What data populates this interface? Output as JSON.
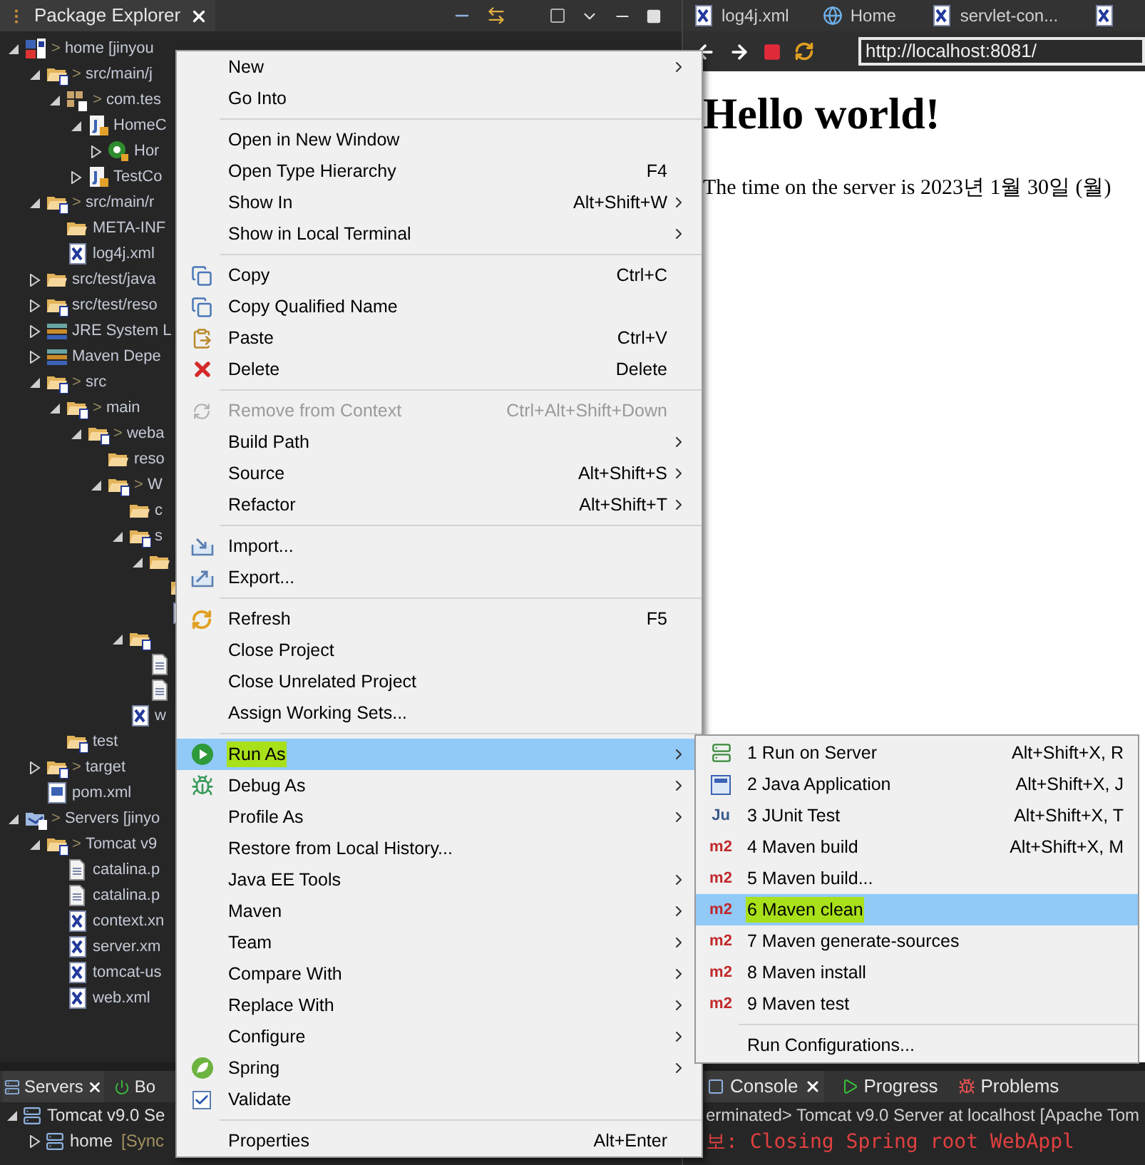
{
  "package_explorer": {
    "title": "Package Explorer",
    "tree": [
      {
        "kind": "project",
        "marker": ">",
        "label": "home [jinyou",
        "expanded": true,
        "children": [
          {
            "kind": "srcfolder",
            "marker": ">",
            "label": "src/main/j",
            "expanded": true,
            "children": [
              {
                "kind": "package",
                "marker": ">",
                "label": "com.tes",
                "expanded": true,
                "children": [
                  {
                    "kind": "javafile",
                    "label": "HomeC",
                    "expanded": true,
                    "children": [
                      {
                        "kind": "class",
                        "label": "Hor",
                        "expanded": false
                      }
                    ]
                  },
                  {
                    "kind": "javafile",
                    "label": "TestCo",
                    "expanded": false
                  }
                ]
              }
            ]
          },
          {
            "kind": "srcfolder",
            "marker": ">",
            "label": "src/main/r",
            "expanded": true,
            "children": [
              {
                "kind": "folder",
                "label": "META-INF"
              },
              {
                "kind": "xml",
                "label": "log4j.xml"
              }
            ]
          },
          {
            "kind": "folder",
            "label": "src/test/java",
            "expanded": false
          },
          {
            "kind": "srcfolder",
            "label": "src/test/reso",
            "expanded": false
          },
          {
            "kind": "library",
            "label": "JRE System L",
            "expanded": false
          },
          {
            "kind": "library",
            "label": "Maven Depe",
            "expanded": false
          },
          {
            "kind": "srcfolder",
            "marker": ">",
            "label": "src",
            "expanded": true,
            "children": [
              {
                "kind": "srcfolder",
                "marker": ">",
                "label": "main",
                "expanded": true,
                "children": [
                  {
                    "kind": "srcfolder",
                    "marker": ">",
                    "label": "weba",
                    "expanded": true,
                    "children": [
                      {
                        "kind": "folder",
                        "label": "reso"
                      },
                      {
                        "kind": "srcfolder",
                        "marker": ">",
                        "label": "W",
                        "expanded": true,
                        "children": [
                          {
                            "kind": "folder",
                            "label": "c"
                          },
                          {
                            "kind": "srcfolder",
                            "label": "s",
                            "expanded": true,
                            "children": [
                              {
                                "kind": "folder",
                                "expanded": true,
                                "children": [
                                  {
                                    "kind": "folder"
                                  },
                                  {
                                    "kind": "xml"
                                  }
                                ]
                              }
                            ]
                          },
                          {
                            "kind": "srcfolder",
                            "expanded": true,
                            "children": [
                              {
                                "kind": "file"
                              },
                              {
                                "kind": "file"
                              }
                            ]
                          },
                          {
                            "kind": "xml",
                            "label": "w"
                          }
                        ]
                      }
                    ]
                  }
                ]
              },
              {
                "kind": "srcfolder",
                "label": "test"
              }
            ]
          },
          {
            "kind": "srcfolder",
            "marker": ">",
            "label": "target",
            "expanded": false
          },
          {
            "kind": "pom",
            "label": "pom.xml"
          }
        ]
      },
      {
        "kind": "serverproject",
        "marker": ">",
        "label": "Servers [jinyo",
        "expanded": true,
        "children": [
          {
            "kind": "srcfolder",
            "marker": ">",
            "label": "Tomcat v9",
            "expanded": true,
            "children": [
              {
                "kind": "file",
                "label": "catalina.p"
              },
              {
                "kind": "file",
                "label": "catalina.p"
              },
              {
                "kind": "xml",
                "label": "context.xn"
              },
              {
                "kind": "xml",
                "label": "server.xm"
              },
              {
                "kind": "xml",
                "label": "tomcat-us"
              },
              {
                "kind": "xml",
                "label": "web.xml"
              }
            ]
          }
        ]
      }
    ]
  },
  "editor": {
    "tabs": [
      {
        "kind": "xml",
        "label": "log4j.xml"
      },
      {
        "kind": "globe",
        "label": "Home"
      },
      {
        "kind": "xml",
        "label": "servlet-con..."
      },
      {
        "kind": "xml"
      }
    ],
    "url": "http://localhost:8081/",
    "heading": "Hello world!",
    "text": "The time on the server is 2023년 1월 30일 (월)"
  },
  "context_menu": {
    "items": [
      {
        "kind": "plain",
        "label": "New",
        "submenu": true,
        "selected": false,
        "disabled": false
      },
      {
        "kind": "plain",
        "label": "Go Into",
        "submenu": false,
        "selected": false,
        "disabled": false
      },
      {
        "kind": "separator"
      },
      {
        "kind": "plain",
        "label": "Open in New Window",
        "submenu": false,
        "selected": false,
        "disabled": false
      },
      {
        "kind": "plain",
        "label": "Open Type Hierarchy",
        "shortcut": "F4",
        "submenu": false,
        "selected": false,
        "disabled": false
      },
      {
        "kind": "plain",
        "label": "Show In",
        "shortcut": "Alt+Shift+W",
        "submenu": true,
        "selected": false,
        "disabled": false
      },
      {
        "kind": "plain",
        "label": "Show in Local Terminal",
        "submenu": true,
        "selected": false,
        "disabled": false
      },
      {
        "kind": "separator"
      },
      {
        "kind": "copy",
        "label": "Copy",
        "shortcut": "Ctrl+C",
        "submenu": false,
        "selected": false,
        "disabled": false
      },
      {
        "kind": "copy",
        "label": "Copy Qualified Name",
        "submenu": false,
        "selected": false,
        "disabled": false
      },
      {
        "kind": "paste",
        "label": "Paste",
        "shortcut": "Ctrl+V",
        "submenu": false,
        "selected": false,
        "disabled": false
      },
      {
        "kind": "delete",
        "label": "Delete",
        "shortcut": "Delete",
        "submenu": false,
        "selected": false,
        "disabled": false
      },
      {
        "kind": "separator"
      },
      {
        "kind": "remove",
        "label": "Remove from Context",
        "shortcut": "Ctrl+Alt+Shift+Down",
        "submenu": false,
        "selected": false,
        "disabled": true
      },
      {
        "kind": "plain",
        "label": "Build Path",
        "submenu": true,
        "selected": false,
        "disabled": false
      },
      {
        "kind": "plain",
        "label": "Source",
        "shortcut": "Alt+Shift+S",
        "submenu": true,
        "selected": false,
        "disabled": false
      },
      {
        "kind": "plain",
        "label": "Refactor",
        "shortcut": "Alt+Shift+T",
        "submenu": true,
        "selected": false,
        "disabled": false
      },
      {
        "kind": "separator"
      },
      {
        "kind": "import",
        "label": "Import...",
        "submenu": false,
        "selected": false,
        "disabled": false
      },
      {
        "kind": "export",
        "label": "Export...",
        "submenu": false,
        "selected": false,
        "disabled": false
      },
      {
        "kind": "separator"
      },
      {
        "kind": "refresh",
        "label": "Refresh",
        "shortcut": "F5",
        "submenu": false,
        "selected": false,
        "disabled": false
      },
      {
        "kind": "plain",
        "label": "Close Project",
        "submenu": false,
        "selected": false,
        "disabled": false
      },
      {
        "kind": "plain",
        "label": "Close Unrelated Project",
        "submenu": false,
        "selected": false,
        "disabled": false
      },
      {
        "kind": "plain",
        "label": "Assign Working Sets...",
        "submenu": false,
        "selected": false,
        "disabled": false
      },
      {
        "kind": "separator"
      },
      {
        "kind": "run",
        "label": "Run As",
        "submenu": true,
        "selected": true,
        "disabled": false
      },
      {
        "kind": "debug",
        "label": "Debug As",
        "submenu": true,
        "selected": false,
        "disabled": false
      },
      {
        "kind": "plain",
        "label": "Profile As",
        "submenu": true,
        "selected": false,
        "disabled": false
      },
      {
        "kind": "plain",
        "label": "Restore from Local History...",
        "submenu": false,
        "selected": false,
        "disabled": false
      },
      {
        "kind": "plain",
        "label": "Java EE Tools",
        "submenu": true,
        "selected": false,
        "disabled": false
      },
      {
        "kind": "plain",
        "label": "Maven",
        "submenu": true,
        "selected": false,
        "disabled": false
      },
      {
        "kind": "plain",
        "label": "Team",
        "submenu": true,
        "selected": false,
        "disabled": false
      },
      {
        "kind": "plain",
        "label": "Compare With",
        "submenu": true,
        "selected": false,
        "disabled": false
      },
      {
        "kind": "plain",
        "label": "Replace With",
        "submenu": true,
        "selected": false,
        "disabled": false
      },
      {
        "kind": "plain",
        "label": "Configure",
        "submenu": true,
        "selected": false,
        "disabled": false
      },
      {
        "kind": "spring",
        "label": "Spring",
        "submenu": true,
        "selected": false,
        "disabled": false
      },
      {
        "kind": "checkbox",
        "label": "Validate",
        "checked": true,
        "submenu": false,
        "selected": false,
        "disabled": false
      },
      {
        "kind": "separator"
      },
      {
        "kind": "plain",
        "label": "Properties",
        "shortcut": "Alt+Enter",
        "submenu": false,
        "selected": false,
        "disabled": false
      }
    ]
  },
  "run_as_menu": {
    "items": [
      {
        "kind": "server",
        "label": "1 Run on Server",
        "shortcut": "Alt+Shift+X, R",
        "selected": false
      },
      {
        "kind": "javaapp",
        "label": "2 Java Application",
        "shortcut": "Alt+Shift+X, J",
        "selected": false
      },
      {
        "kind": "badge",
        "badge": "Ju",
        "label": "3 JUnit Test",
        "shortcut": "Alt+Shift+X, T",
        "selected": false
      },
      {
        "kind": "badge",
        "badge": "m2",
        "label": "4 Maven build",
        "shortcut": "Alt+Shift+X, M",
        "selected": false
      },
      {
        "kind": "badge",
        "badge": "m2",
        "label": "5 Maven build...",
        "selected": false
      },
      {
        "kind": "badge",
        "badge": "m2",
        "label": "6 Maven clean",
        "selected": true
      },
      {
        "kind": "badge",
        "badge": "m2",
        "label": "7 Maven generate-sources",
        "selected": false
      },
      {
        "kind": "badge",
        "badge": "m2",
        "label": "8 Maven install",
        "selected": false
      },
      {
        "kind": "badge",
        "badge": "m2",
        "label": "9 Maven test",
        "selected": false
      },
      {
        "kind": "separator"
      },
      {
        "kind": "plain",
        "label": "Run Configurations...",
        "selected": false
      }
    ]
  },
  "servers_view": {
    "tabs": [
      {
        "label": "Servers",
        "selected": true
      },
      {
        "label": "Bo",
        "selected": false
      }
    ],
    "tree": [
      {
        "label": "Tomcat v9.0 Se",
        "expanded": true,
        "children": [
          {
            "label": "home",
            "status": "[Sync",
            "expanded": false
          }
        ]
      }
    ]
  },
  "console_view": {
    "tabs": [
      {
        "kind": "console",
        "label": "Console",
        "selected": true
      },
      {
        "kind": "progress",
        "label": "Progress",
        "selected": false
      },
      {
        "kind": "problems",
        "label": "Problems",
        "selected": false
      }
    ],
    "header": "erminated> Tomcat v9.0 Server at localhost [Apache Tom",
    "lines": [
      "보: Closing Spring root WebAppl"
    ]
  }
}
